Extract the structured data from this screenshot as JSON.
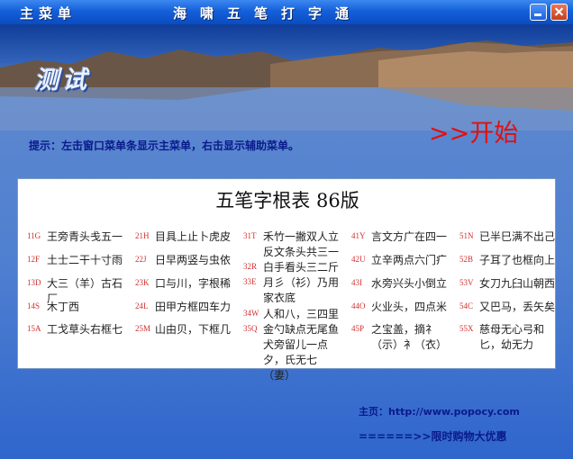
{
  "titlebar": {
    "menu_label": "主菜单",
    "app_title": "海啸五笔打字通",
    "minimize_icon": "minimize-icon",
    "close_icon": "close-icon"
  },
  "banner": {
    "test_label": "测试"
  },
  "hint": "提示：左击窗口菜单条显示主菜单，右击显示辅助菜单。",
  "start_label": ">>开始",
  "table": {
    "title": "五笔字根表 86版",
    "columns": [
      [
        {
          "code": "11G",
          "roots": "王旁青头戋五一"
        },
        {
          "code": "12F",
          "roots": "土士二干十寸雨"
        },
        {
          "code": "13D",
          "roots": "大三（羊）古石厂"
        },
        {
          "code": "14S",
          "roots": "木丁西"
        },
        {
          "code": "15A",
          "roots": "工戈草头右框七"
        }
      ],
      [
        {
          "code": "21H",
          "roots": "目具上止卜虎皮"
        },
        {
          "code": "22J",
          "roots": "日早两竖与虫依"
        },
        {
          "code": "23K",
          "roots": "口与川，字根稀"
        },
        {
          "code": "24L",
          "roots": "田甲方框四车力"
        },
        {
          "code": "25M",
          "roots": "山由贝，下框几"
        }
      ],
      [
        {
          "code": "31T",
          "roots": "禾竹一撇双人立 反文条头共三一"
        },
        {
          "code": "32R",
          "roots": "白手看头三二斤"
        },
        {
          "code": "33E",
          "roots": "月彡（衫）乃用家衣底"
        },
        {
          "code": "34W",
          "roots": "人和八，三四里"
        },
        {
          "code": "35Q",
          "roots": "金勺缺点无尾鱼 犬旁留儿一点夕，氏无七（妻）"
        }
      ],
      [
        {
          "code": "41Y",
          "roots": "言文方广在四一"
        },
        {
          "code": "42U",
          "roots": "立辛两点六门疒"
        },
        {
          "code": "43I",
          "roots": "水旁兴头小倒立"
        },
        {
          "code": "44O",
          "roots": "火业头，四点米"
        },
        {
          "code": "45P",
          "roots": "之宝盖，摘礻（示）衤（衣）"
        }
      ],
      [
        {
          "code": "51N",
          "roots": "已半巳满不出己"
        },
        {
          "code": "52B",
          "roots": "子耳了也框向上"
        },
        {
          "code": "53V",
          "roots": "女刀九臼山朝西"
        },
        {
          "code": "54C",
          "roots": "又巴马，丢矢矣"
        },
        {
          "code": "55X",
          "roots": "慈母无心弓和匕，幼无力"
        }
      ]
    ]
  },
  "homepage": "主页：http://www.popocy.com",
  "promo": "======>>限时购物大优惠",
  "colors": {
    "titlebar": "#1460d9",
    "start": "#e01010",
    "code": "#d23030",
    "text_blue": "#0a1a8c"
  }
}
